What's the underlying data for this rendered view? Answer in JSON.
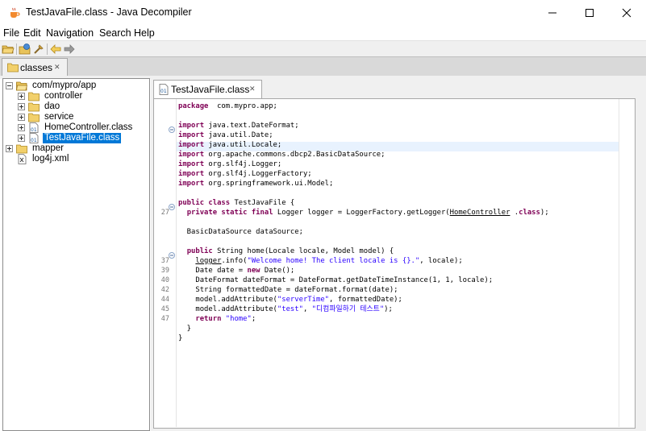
{
  "window": {
    "title": "TestJavaFile.class - Java Decompiler"
  },
  "menu": [
    "File",
    "Edit",
    "Navigation",
    "Search",
    "Help"
  ],
  "toolbar": {
    "icons": [
      "open-folder-icon",
      "open-type-icon",
      "settings-icon",
      "back-icon",
      "forward-icon"
    ]
  },
  "project_tab": {
    "label": "classes"
  },
  "tree": {
    "root": "com/mypro/app",
    "children": [
      "controller",
      "dao",
      "service",
      "HomeController.class",
      "TestJavaFile.class"
    ],
    "siblings": [
      "mapper",
      "log4j.xml"
    ]
  },
  "editor_tab": {
    "label": "TestJavaFile.class"
  },
  "code": {
    "lines": [
      {
        "num": "",
        "parts": [
          [
            "kw",
            "package"
          ],
          [
            "",
            "  com.mypro.app;"
          ]
        ]
      },
      {
        "num": "",
        "parts": []
      },
      {
        "num": "",
        "parts": [
          [
            "kw",
            "import"
          ],
          [
            "",
            " java.text.DateFormat;"
          ]
        ]
      },
      {
        "num": "",
        "parts": [
          [
            "kw",
            "import"
          ],
          [
            "",
            " java.util.Date;"
          ]
        ]
      },
      {
        "num": "",
        "parts": [
          [
            "kw",
            "import"
          ],
          [
            "",
            " java.util.Locale;"
          ]
        ]
      },
      {
        "num": "",
        "parts": [
          [
            "kw",
            "import"
          ],
          [
            "",
            " org.apache.commons.dbcp2.BasicDataSource;"
          ]
        ]
      },
      {
        "num": "",
        "parts": [
          [
            "kw",
            "import"
          ],
          [
            "",
            " org.slf4j.Logger;"
          ]
        ]
      },
      {
        "num": "",
        "parts": [
          [
            "kw",
            "import"
          ],
          [
            "",
            " org.slf4j.LoggerFactory;"
          ]
        ]
      },
      {
        "num": "",
        "parts": [
          [
            "kw",
            "import"
          ],
          [
            "",
            " org.springframework.ui.Model;"
          ]
        ]
      },
      {
        "num": "",
        "parts": []
      },
      {
        "num": "",
        "parts": [
          [
            "kw",
            "public class"
          ],
          [
            "",
            " TestJavaFile {"
          ]
        ]
      },
      {
        "num": "27",
        "parts": [
          [
            "",
            "  "
          ],
          [
            "kw",
            "private static final"
          ],
          [
            "",
            " Logger logger = LoggerFactory.getLogger("
          ],
          [
            "ul",
            "HomeController"
          ],
          [
            "",
            " ."
          ],
          [
            "kw",
            "class"
          ],
          [
            "",
            ");"
          ]
        ]
      },
      {
        "num": "",
        "parts": []
      },
      {
        "num": "",
        "parts": [
          [
            "",
            "  BasicDataSource dataSource;"
          ]
        ]
      },
      {
        "num": "",
        "parts": []
      },
      {
        "num": "",
        "parts": [
          [
            "",
            "  "
          ],
          [
            "kw",
            "public"
          ],
          [
            "",
            " String home(Locale locale, Model model) {"
          ]
        ]
      },
      {
        "num": "37",
        "parts": [
          [
            "",
            "    "
          ],
          [
            "ul",
            "logger"
          ],
          [
            "",
            ".info("
          ],
          [
            "str",
            "\"Welcome home! The client locale is {}.\""
          ],
          [
            "",
            ", locale);"
          ]
        ]
      },
      {
        "num": "39",
        "parts": [
          [
            "",
            "    Date date = "
          ],
          [
            "kw",
            "new"
          ],
          [
            "",
            " Date();"
          ]
        ]
      },
      {
        "num": "40",
        "parts": [
          [
            "",
            "    DateFormat dateFormat = DateFormat.getDateTimeInstance(1, 1, locale);"
          ]
        ]
      },
      {
        "num": "42",
        "parts": [
          [
            "",
            "    String formattedDate = dateFormat.format(date);"
          ]
        ]
      },
      {
        "num": "44",
        "parts": [
          [
            "",
            "    model.addAttribute("
          ],
          [
            "str",
            "\"serverTime\""
          ],
          [
            "",
            ", formattedDate);"
          ]
        ]
      },
      {
        "num": "45",
        "parts": [
          [
            "",
            "    model.addAttribute("
          ],
          [
            "str",
            "\"test\""
          ],
          [
            "",
            ", "
          ],
          [
            "str",
            "\"디컴파일하기 테스트\""
          ],
          [
            "",
            ");"
          ]
        ]
      },
      {
        "num": "47",
        "parts": [
          [
            "",
            "    "
          ],
          [
            "kw",
            "return"
          ],
          [
            "",
            " "
          ],
          [
            "str",
            "\"home\""
          ],
          [
            "",
            ";"
          ]
        ]
      },
      {
        "num": "",
        "parts": [
          [
            "",
            "  }"
          ]
        ]
      },
      {
        "num": "",
        "parts": [
          [
            "",
            "}"
          ]
        ]
      }
    ]
  },
  "colors": {
    "selection": "#0078d7",
    "keyword": "#7f0055",
    "string": "#2a00ff",
    "highlight_line": "#e8f2fe"
  }
}
